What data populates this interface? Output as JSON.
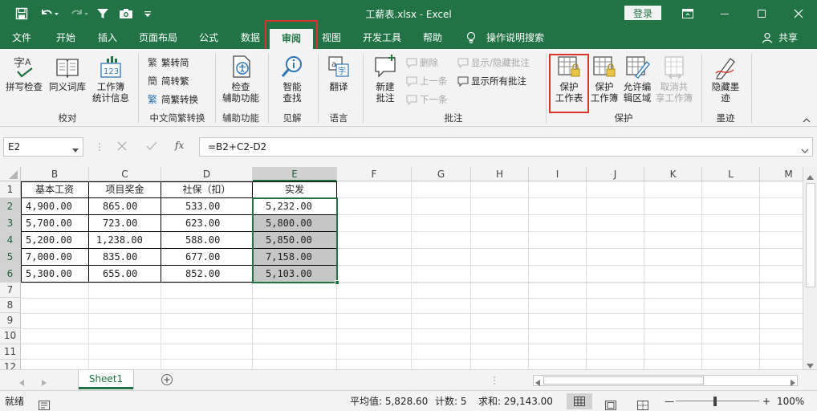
{
  "titlebar": {
    "title": "工薪表.xlsx  -  Excel",
    "login": "登录"
  },
  "menu": {
    "tabs": [
      "文件",
      "开始",
      "插入",
      "页面布局",
      "公式",
      "数据",
      "审阅",
      "视图",
      "开发工具",
      "帮助"
    ],
    "active_tab": "审阅",
    "tell_me": "操作说明搜索",
    "share": "共享"
  },
  "ribbon": {
    "proofing": {
      "spell": "拼写检查",
      "thesaurus": "同义词库",
      "stats_line1": "工作簿",
      "stats_line2": "统计信息",
      "group": "校对"
    },
    "chinese": {
      "t2s": "繁转简",
      "s2t": "简转繁",
      "convert": "简繁转换",
      "group": "中文简繁转换"
    },
    "accessibility": {
      "check_line1": "检查",
      "check_line2": "辅助功能",
      "group": "辅助功能"
    },
    "insights": {
      "smart_line1": "智能",
      "smart_line2": "查找",
      "group": "见解"
    },
    "language": {
      "translate": "翻译",
      "group": "语言"
    },
    "comments": {
      "new_line1": "新建",
      "new_line2": "批注",
      "delete": "删除",
      "prev": "上一条",
      "next": "下一条",
      "show_hide": "显示/隐藏批注",
      "show_all": "显示所有批注",
      "group": "批注"
    },
    "protect": {
      "sheet_line1": "保护",
      "sheet_line2": "工作表",
      "book_line1": "保护",
      "book_line2": "工作簿",
      "edit_line1": "允许编",
      "edit_line2": "辑区域",
      "unshare_line1": "取消共",
      "unshare_line2": "享工作簿",
      "group": "保护"
    },
    "ink": {
      "hide_line1": "隐藏墨",
      "hide_line2": "迹",
      "group": "墨迹"
    }
  },
  "formula_bar": {
    "name_box": "E2",
    "formula": "=B2+C2-D2",
    "fx": "fx"
  },
  "sheet": {
    "columns": [
      "B",
      "C",
      "D",
      "E",
      "F",
      "G",
      "H",
      "I",
      "J",
      "K",
      "L",
      "M"
    ],
    "rows": [
      "1",
      "2",
      "3",
      "4",
      "5",
      "6",
      "7",
      "8",
      "9",
      "10",
      "11",
      "12"
    ],
    "headers": [
      "基本工资",
      "项目奖金",
      "社保（扣）",
      "实发"
    ],
    "data": [
      [
        "4,900.00",
        "865.00",
        "533.00",
        "5,232.00"
      ],
      [
        "5,700.00",
        "723.00",
        "623.00",
        "5,800.00"
      ],
      [
        "5,200.00",
        "1,238.00",
        "588.00",
        "5,850.00"
      ],
      [
        "7,000.00",
        "835.00",
        "677.00",
        "7,158.00"
      ],
      [
        "5,300.00",
        "655.00",
        "852.00",
        "5,103.00"
      ]
    ],
    "tab_name": "Sheet1"
  },
  "status": {
    "ready": "就绪",
    "average": "平均值: 5,828.60",
    "count": "计数: 5",
    "sum": "求和: 29,143.00",
    "zoom": "100%"
  },
  "colors": {
    "excel_green": "#217346",
    "highlight_red": "#d9342b"
  }
}
